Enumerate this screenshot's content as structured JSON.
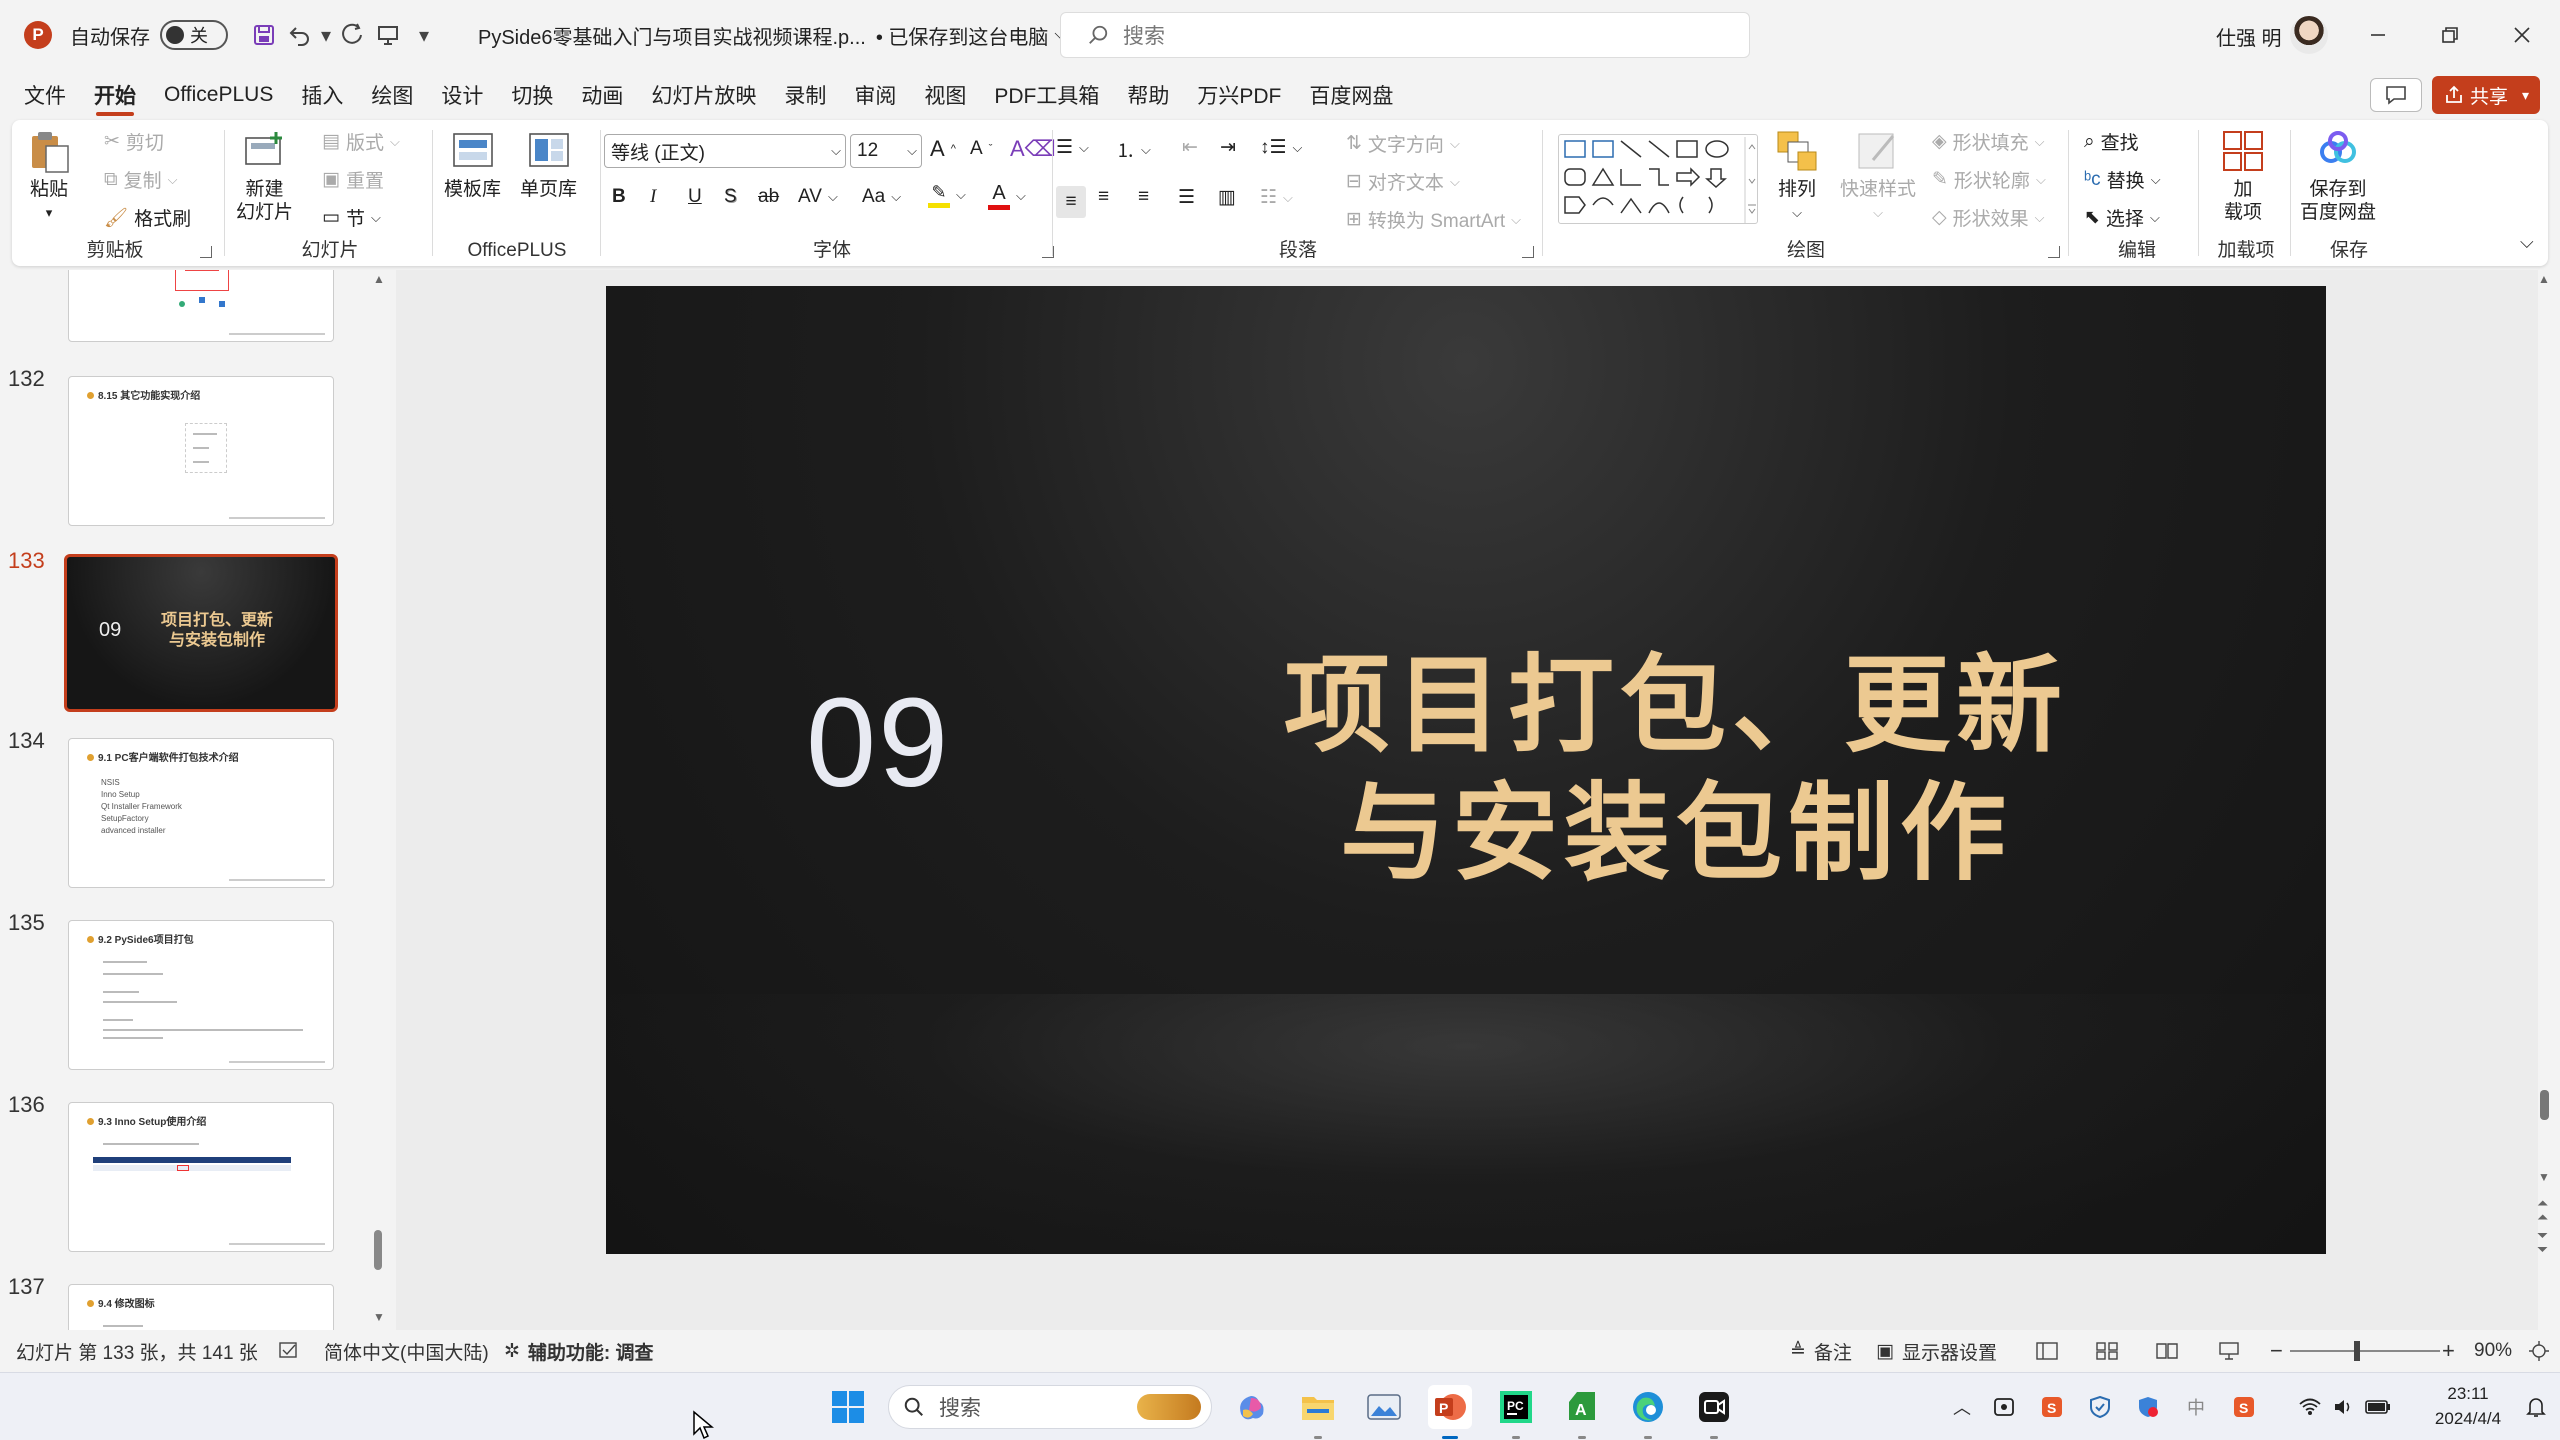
{
  "titlebar": {
    "app_icon": "P",
    "autosave_label": "自动保存",
    "autosave_state": "关",
    "doc_title": "PySide6零基础入门与项目实战视频课程.p...",
    "save_status": "• 已保存到这台电脑",
    "search_placeholder": "搜索",
    "user_name": "仕强 明"
  },
  "menu": {
    "tabs": [
      "文件",
      "开始",
      "OfficePLUS",
      "插入",
      "绘图",
      "设计",
      "切换",
      "动画",
      "幻灯片放映",
      "录制",
      "审阅",
      "视图",
      "PDF工具箱",
      "帮助",
      "万兴PDF",
      "百度网盘"
    ],
    "active": "开始",
    "share_label": "共享"
  },
  "ribbon": {
    "clipboard": {
      "label": "剪贴板",
      "paste": "粘贴",
      "cut": "剪切",
      "copy": "复制",
      "format_painter": "格式刷"
    },
    "slides": {
      "label": "幻灯片",
      "new_slide_1": "新建",
      "new_slide_2": "幻灯片",
      "layout": "版式",
      "reset": "重置",
      "section": "节"
    },
    "officeplus": {
      "label": "OfficePLUS",
      "templates": "模板库",
      "single_page": "单页库"
    },
    "font": {
      "label": "字体",
      "font_name": "等线 (正文)",
      "font_size": "12",
      "bold": "B",
      "italic": "I",
      "underline": "U",
      "shadow": "S",
      "strike": "ab",
      "spacing": "AV",
      "case": "Aa",
      "grow": "A",
      "shrink": "A"
    },
    "paragraph": {
      "label": "段落",
      "text_direction": "文字方向",
      "align_text": "对齐文本",
      "smartart": "转换为 SmartArt"
    },
    "drawing": {
      "label": "绘图",
      "arrange": "排列",
      "quick_styles": "快速样式",
      "shape_fill": "形状填充",
      "shape_outline": "形状轮廓",
      "shape_effects": "形状效果"
    },
    "editing": {
      "label": "编辑",
      "find": "查找",
      "replace": "替换",
      "select": "选择"
    },
    "addins": {
      "label": "加载项",
      "btn_1": "加",
      "btn_2": "载项"
    },
    "save": {
      "label": "保存",
      "btn_1": "保存到",
      "btn_2": "百度网盘"
    }
  },
  "thumbnails": [
    {
      "num": "132",
      "title": "8.15 其它功能实现介绍",
      "kind": "text"
    },
    {
      "num": "133",
      "title": "项目打包、更新与安装包制作",
      "kind": "section",
      "section_num": "09",
      "title_1": "项目打包、更新",
      "title_2": "与安装包制作"
    },
    {
      "num": "134",
      "title": "9.1 PC客户端软件打包技术介绍",
      "kind": "list",
      "lines": [
        "NSIS",
        "Inno Setup",
        "Qt Installer Framework",
        "SetupFactory",
        "advanced installer"
      ]
    },
    {
      "num": "135",
      "title": "9.2 PySide6项目打包",
      "kind": "text"
    },
    {
      "num": "136",
      "title": "9.3 Inno Setup使用介绍",
      "kind": "table"
    },
    {
      "num": "137",
      "title": "9.4 修改图标",
      "kind": "text"
    }
  ],
  "slide": {
    "number": "09",
    "title_line1": "项目打包、更新",
    "title_line2": "与安装包制作"
  },
  "status": {
    "slide_info": "幻灯片 第 133 张，共 141 张",
    "language": "简体中文(中国大陆)",
    "accessibility": "辅助功能: 调查",
    "notes": "备注",
    "display_settings": "显示器设置",
    "zoom": "90%",
    "zoom_level": 0.9
  },
  "taskbar": {
    "search_placeholder": "搜索",
    "time": "23:11",
    "date": "2024/4/4",
    "ime": "中"
  },
  "colors": {
    "accent": "#c43e1c",
    "slide_title": "#ecc991",
    "slide_bg": "#1a1a1a"
  }
}
